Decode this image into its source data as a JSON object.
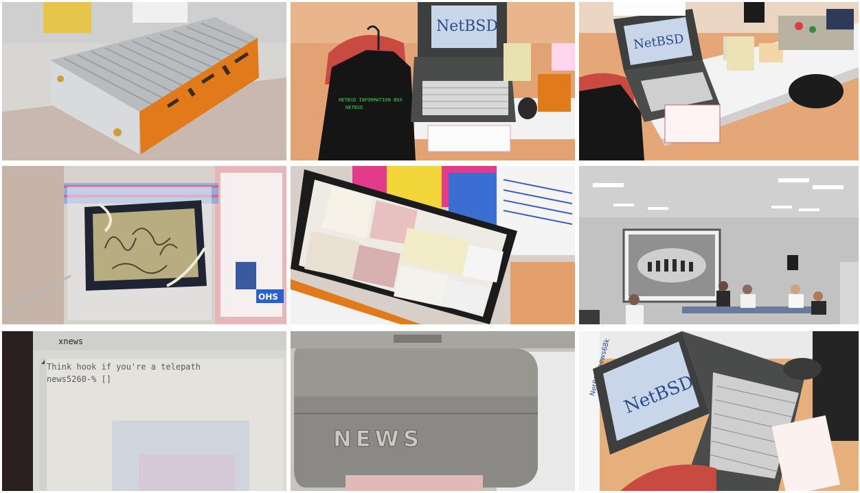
{
  "tiles": [
    {
      "id": "photo-router-box"
    },
    {
      "id": "photo-netbsd-laptop-tshirt"
    },
    {
      "id": "photo-booth-table"
    },
    {
      "id": "photo-etched-plate"
    },
    {
      "id": "photo-sticker-case"
    },
    {
      "id": "photo-seminar-room"
    },
    {
      "id": "photo-terminal-screen"
    },
    {
      "id": "photo-news-case"
    },
    {
      "id": "photo-netbsd-laptop-closeup"
    }
  ],
  "texts": {
    "netbsd_screen_1": "NetBSD",
    "netbsd_screen_3": "NetBSD",
    "netbsd_screen_9": "NetBSD",
    "tshirt_line_1": "NETBSD INFORMATION BOX",
    "tshirt_line_2": "NETBSD",
    "terminal_title": "xnews",
    "terminal_line_1": "Think hook if you're a telepath",
    "terminal_line_2": "news5260-% []",
    "news_logo": "NEWS",
    "sticker_label": "OHS",
    "side_banner": "NetBSD/news68k"
  },
  "colors": {
    "orange": "#e07a1a",
    "screen": "#c9d6ea",
    "laptop_body": "#3d3f3f",
    "floor": "#e2a274",
    "projector": "#d9d9d9"
  }
}
